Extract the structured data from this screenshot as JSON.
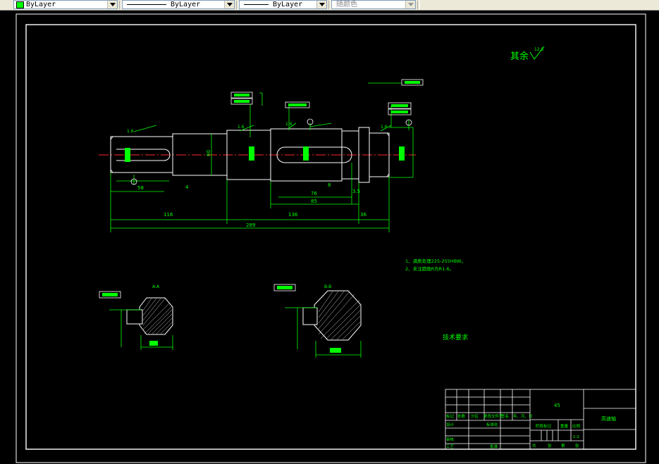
{
  "toolbar": {
    "color": {
      "value": "ByLayer",
      "swatch": "#00ff00"
    },
    "linetype": {
      "value": "ByLayer"
    },
    "lineweight": {
      "value": "ByLayer"
    },
    "plotstyle": {
      "value": "随颜色"
    }
  },
  "drawing": {
    "roughness_note": "其余",
    "roughness_value": "12.5",
    "tech_req_title": "技术要求",
    "tech_req_items": [
      "1、调质处理225-255HBW。",
      "2、未注圆角R为R1.6。"
    ],
    "section_a_label": "A-A",
    "section_b_label": "B-B",
    "dims": {
      "len_116": "116",
      "len_136": "136",
      "len_36": "36",
      "len_289": "289",
      "len_76": "76",
      "len_85": "85",
      "len_58": "58",
      "len_4": "4",
      "len_8": "8",
      "len_3_5": "3.5",
      "dia_60": "60"
    },
    "title_block": {
      "material": "45",
      "part_name": "高速轴",
      "scale": "1:2",
      "labels": {
        "mark": "标记",
        "count": "处数",
        "zone": "分区",
        "doc_no": "更改文件号",
        "sign": "签名",
        "date": "年、月、日",
        "design": "设计",
        "standard": "标准化",
        "stage": "阶段标记",
        "weight": "重量",
        "ratio": "比例",
        "review": "审核",
        "process": "工艺",
        "approve": "批准",
        "total": "共",
        "sheets": "张",
        "page": "第",
        "sheet2": "张"
      }
    }
  }
}
